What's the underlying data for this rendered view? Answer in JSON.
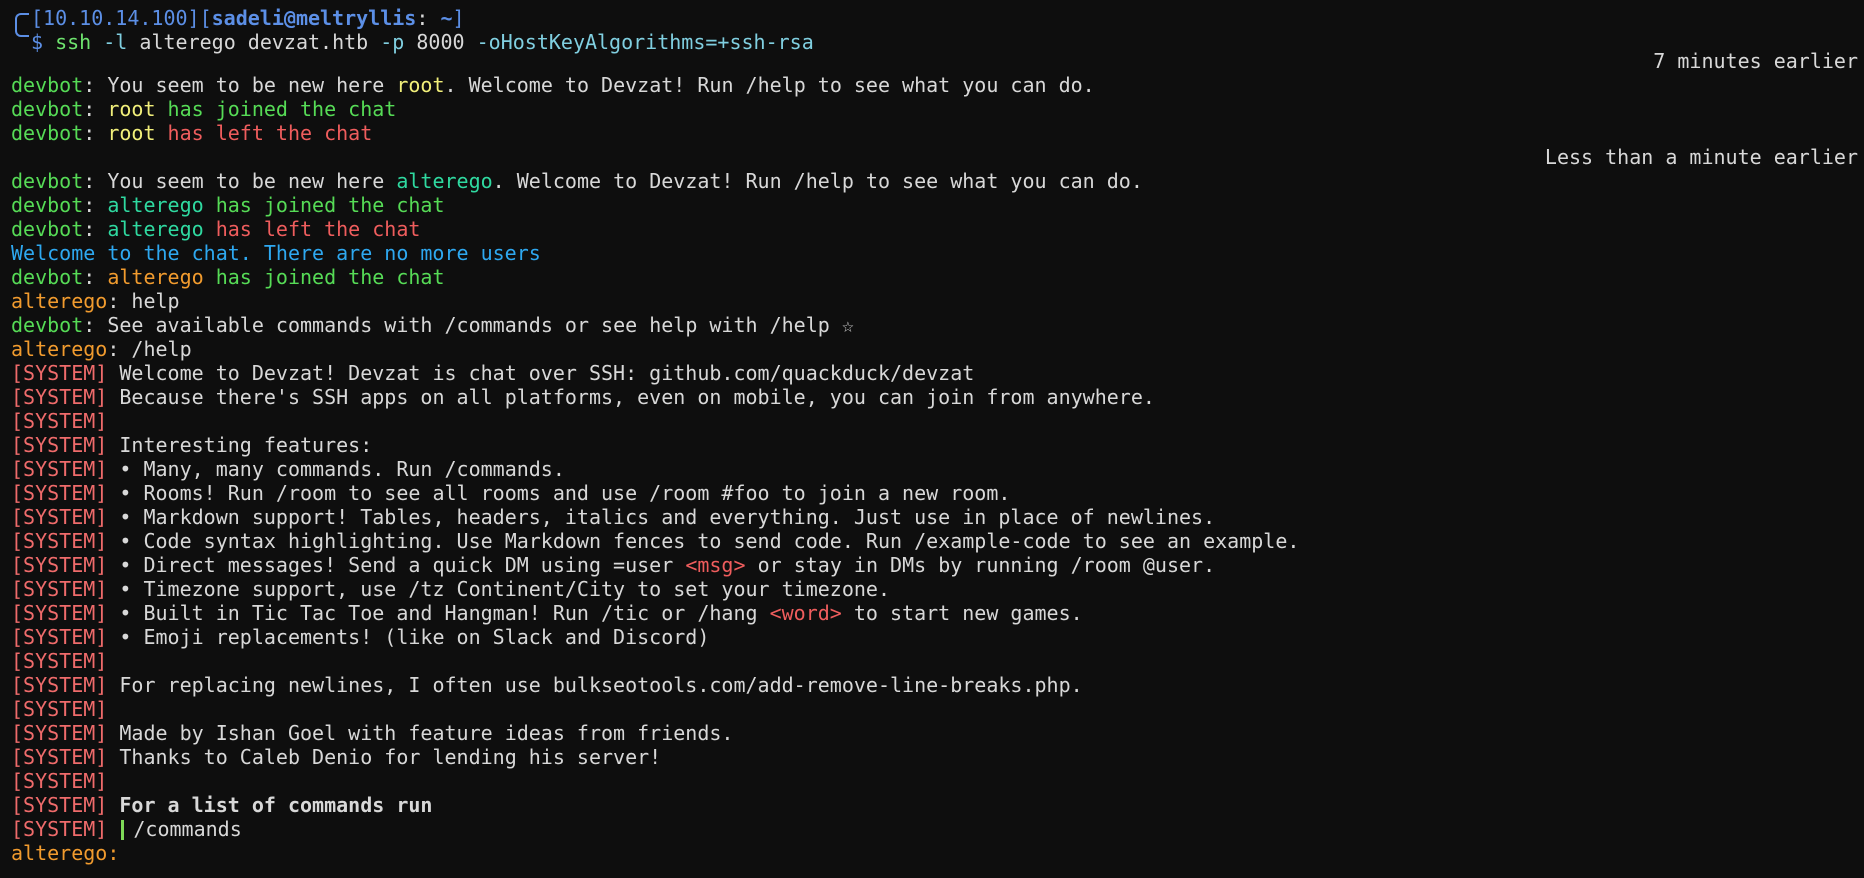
{
  "terminal": {
    "prompt": {
      "ip": "10.10.14.100",
      "user": "sadeli",
      "host": "meltryllis",
      "path": "~"
    },
    "command": {
      "program": "ssh",
      "flag_l": "-l",
      "user": "alterego",
      "target": "devzat.htb",
      "flag_p": "-p",
      "port": "8000",
      "option": "-oHostKeyAlgorithms=+ssh-rsa"
    },
    "separators": {
      "bot": "devbot",
      "colon": ":",
      "sys": "[SYSTEM]",
      "bracket_open": "[",
      "bracket_close": "]",
      "at": "@",
      "dollar": "$",
      "space_colon": ": "
    },
    "timestamps": {
      "first": "7 minutes earlier",
      "second": "Less than a minute earlier"
    },
    "messages": {
      "m1a": "You seem to be new here ",
      "m1b": "root",
      "m1c": ". Welcome to Devzat! Run /help to see what you can do.",
      "m2a": "root",
      "m2b": " has joined the chat",
      "m3a": "root",
      "m3b": " has left the chat",
      "m4a": "You seem to be new here ",
      "m4b": "alterego",
      "m4c": ". Welcome to Devzat! Run /help to see what you can do.",
      "m5a": "alterego",
      "m5b": " has joined the chat",
      "m6a": "alterego",
      "m6b": " has left the chat",
      "m7": "Welcome to the chat. There are no more users",
      "m8a": "alterego",
      "m8b": " has joined the chat",
      "m9_user": "alterego",
      "m9_text": "help",
      "m10": "See available commands with /commands or see help with /help ☆",
      "m11_user": "alterego",
      "m11_text": "/help"
    },
    "system": {
      "s1": "Welcome to Devzat! Devzat is chat over SSH: github.com/quackduck/devzat",
      "s2": "Because there's SSH apps on all platforms, even on mobile, you can join from anywhere.",
      "s4": "Interesting features:",
      "s5": "• Many, many commands. Run /commands.",
      "s6": "• Rooms! Run /room to see all rooms and use /room #foo to join a new room.",
      "s7": "• Markdown support! Tables, headers, italics and everything. Just use in place of newlines.",
      "s8": "• Code syntax highlighting. Use Markdown fences to send code. Run /example-code to see an example.",
      "s9a": "• Direct messages! Send a quick DM using =user ",
      "s9b": "<msg>",
      "s9c": " or stay in DMs by running /room @user.",
      "s10": "• Timezone support, use /tz Continent/City to set your timezone.",
      "s11a": "• Built in Tic Tac Toe and Hangman! Run /tic or /hang ",
      "s11b": "<word>",
      "s11c": " to start new games.",
      "s12": "• Emoji replacements! (like on Slack and Discord)",
      "s14": "For replacing newlines, I often use bulkseotools.com/add-remove-line-breaks.php.",
      "s16": "Made by Ishan Goel with feature ideas from friends.",
      "s17": "Thanks to Caleb Denio for lending his server!",
      "s19": "For a list of commands run",
      "s20": "/commands"
    },
    "input_prompt_user": "alterego",
    "colors": {
      "background": "#0e0e0e",
      "prompt_blue": "#5c8fe6",
      "bot_green": "#56db56",
      "root_yellow": "#f1ef7a",
      "left_red": "#ef5d5d",
      "alterego_teal": "#2fd9a0",
      "info_blue": "#2ea8f0",
      "user_orange": "#f19b2e",
      "system_red": "#ef6b6b"
    }
  }
}
